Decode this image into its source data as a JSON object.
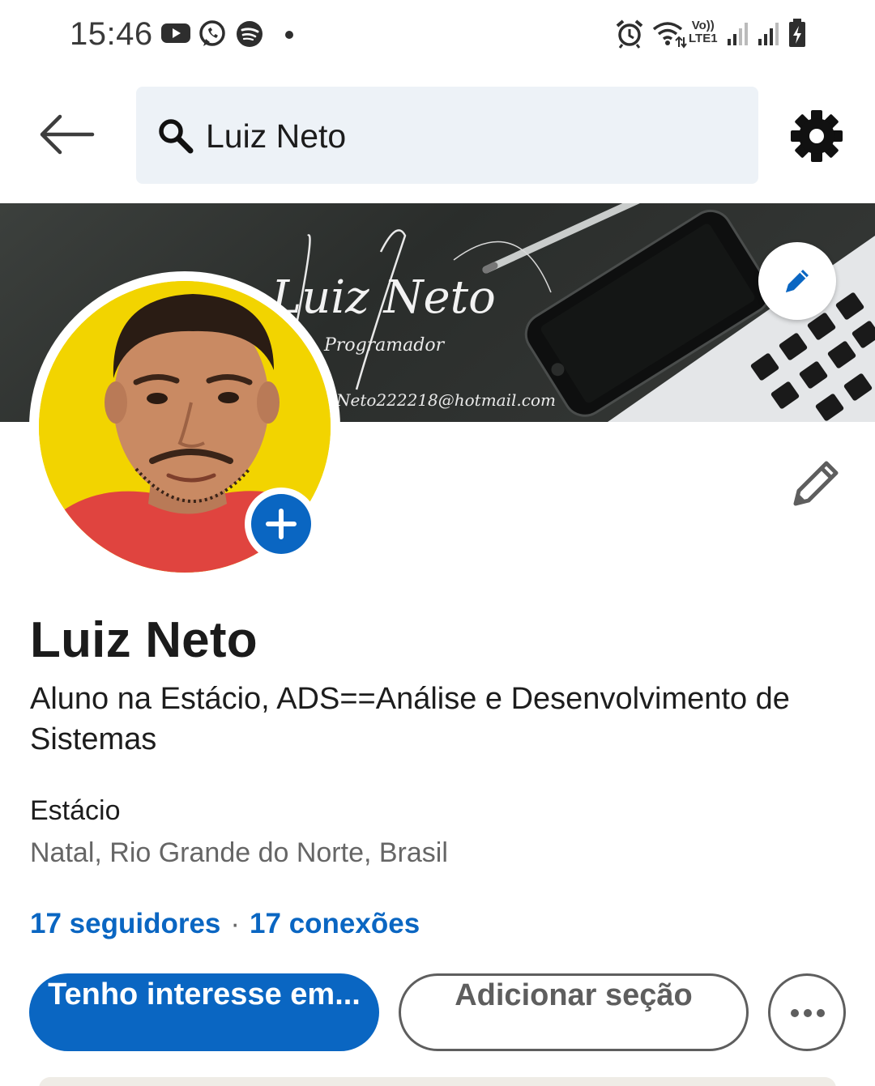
{
  "status_bar": {
    "time": "15:46",
    "left_icons": [
      "youtube-icon",
      "whatsapp-icon",
      "spotify-icon",
      "notification-dot-icon"
    ],
    "right_icons": [
      "alarm-icon",
      "wifi-icon",
      "volte-lte-icon",
      "signal-icon",
      "signal-icon",
      "battery-charging-icon"
    ],
    "volte_label": "Vo))",
    "lte_label": "LTE1"
  },
  "top_bar": {
    "back_icon": "arrow-left-icon",
    "search_query": "Luiz Neto",
    "settings_icon": "gear-icon"
  },
  "cover": {
    "signature_name": "Luiz Neto",
    "signature_subtitle": "Programador",
    "signature_email": "Neto222218@hotmail.com",
    "edit_icon": "pencil-icon"
  },
  "profile": {
    "name": "Luiz Neto",
    "headline": "Aluno na Estácio, ADS==Análise e Desenvolvimento de Sistemas",
    "company": "Estácio",
    "location": "Natal, Rio Grande do Norte, Brasil",
    "followers": "17 seguidores",
    "separator": "·",
    "connections": "17 conexões"
  },
  "actions": {
    "primary_label": "Tenho interesse em...",
    "secondary_label": "Adicionar seção",
    "more_icon": "more-horizontal-icon"
  },
  "colors": {
    "accent": "#0a66c2",
    "search_bg": "#edf2f7",
    "avatar_bg": "#f2d400",
    "muted_text": "#666666"
  }
}
